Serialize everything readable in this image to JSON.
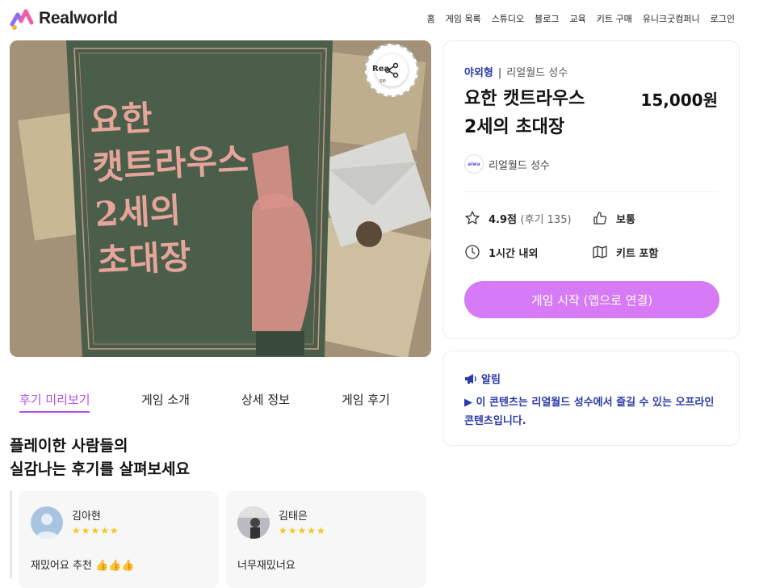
{
  "header": {
    "logo_text": "Realworld",
    "nav": [
      "홈",
      "게임 목록",
      "스튜디오",
      "블로그",
      "교육",
      "키트 구매",
      "유니크굿컴퍼니",
      "로그인"
    ]
  },
  "cover": {
    "title_lines": [
      "요한",
      "캣트라우스",
      "2세의",
      "초대장"
    ],
    "badge_text": "Rea",
    "badge_sub": "se"
  },
  "tabs": [
    "후기 미리보기",
    "게임 소개",
    "상세 정보",
    "게임 후기"
  ],
  "reviews": {
    "heading_line1": "플레이한 사람들의",
    "heading_line2": "실감나는 후기를 살펴보세요",
    "items": [
      {
        "name": "김아현",
        "stars": "★★★★★",
        "text": "재밌어요 추천 👍👍👍"
      },
      {
        "name": "김태은",
        "stars": "★★★★★",
        "text": "너무재밌너요"
      }
    ]
  },
  "info": {
    "category": "야외형",
    "location": "리얼월드 성수",
    "title_line1": "요한 캣트라우스",
    "title_line2": "2세의 초대장",
    "price": "15,000원",
    "creator_logo": "aiwa",
    "creator": "리얼월드 성수",
    "rating": "4.9점",
    "review_count": "(후기 135)",
    "difficulty": "보통",
    "duration": "1시간 내외",
    "kit": "키트 포함",
    "cta": "게임 시작 (앱으로 연결)"
  },
  "notice": {
    "title": "알림",
    "text": "▶ 이 콘텐츠는 리얼월드 성수에서 즐길 수 있는 오프라인 콘텐츠입니다."
  },
  "colors": {
    "accent": "#b44fe2",
    "cta": "#d67af5",
    "notice": "#2a3aa8"
  }
}
